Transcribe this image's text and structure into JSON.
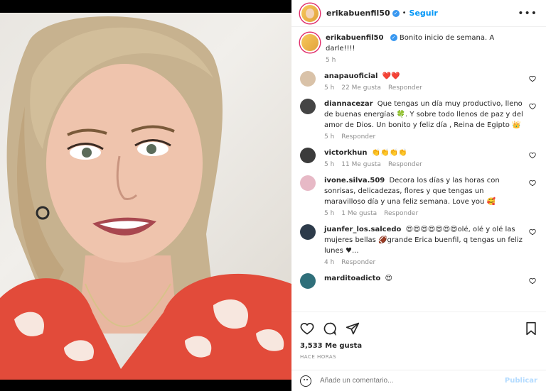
{
  "post": {
    "username": "erikabuenfil50",
    "follow_label": "Seguir",
    "caption": "Bonito inicio de semana. A darle!!!!",
    "caption_age": "5 h"
  },
  "comments": [
    {
      "user": "anapauoficial",
      "text": "❤️❤️",
      "age": "5 h",
      "likes": "22 Me gusta",
      "reply": "Responder"
    },
    {
      "user": "diannacezar",
      "text": "Que tengas un día muy productivo, lleno de buenas energías 🍀. Y sobre todo llenos de paz y del amor de Dios. Un bonito y feliz día , Reina de Egipto 👑",
      "age": "5 h",
      "likes": "",
      "reply": "Responder"
    },
    {
      "user": "victorkhun",
      "text": "👏👏👏👏",
      "age": "5 h",
      "likes": "11 Me gusta",
      "reply": "Responder"
    },
    {
      "user": "ivone.silva.509",
      "text": "Decora los días y las horas con sonrisas, delicadezas, flores y que tengas un maravilloso día y una feliz semana. Love you 🥰",
      "age": "5 h",
      "likes": "1 Me gusta",
      "reply": "Responder"
    },
    {
      "user": "juanfer_los.salcedo",
      "text": "😍😍😍😍😍😍😍olé, olé y olé las mujeres bellas 🏈grande Erica buenfil, q tengas un feliz lunes ♥...",
      "age": "4 h",
      "likes": "",
      "reply": "Responder"
    },
    {
      "user": "marditoadicto",
      "text": "😍",
      "age": "",
      "likes": "",
      "reply": ""
    }
  ],
  "actions": {
    "likes": "3,533 Me gusta",
    "time": "Hace horas",
    "comment_placeholder": "Añade un comentario...",
    "post_label": "Publicar"
  },
  "colors": {
    "accent": "#0095f6",
    "muted": "#8e8e8e",
    "text": "#262626"
  }
}
